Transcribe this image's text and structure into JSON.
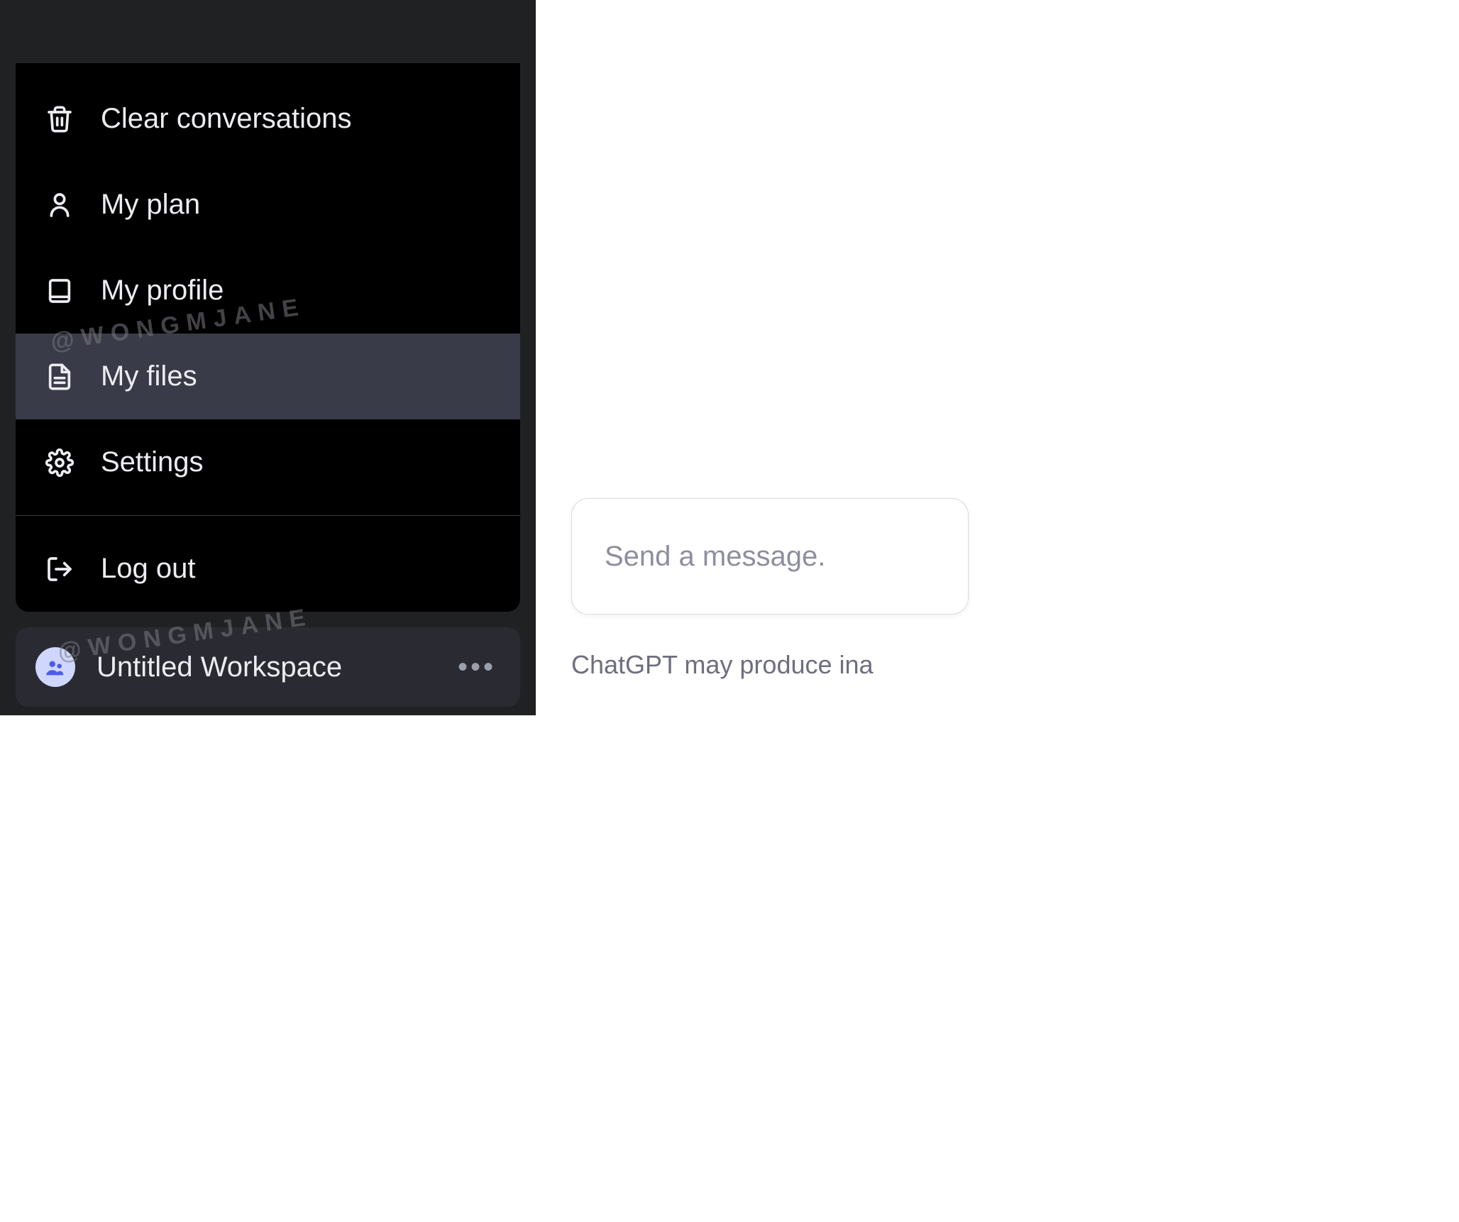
{
  "sidebar": {
    "items": [
      {
        "label": "Clear conversations",
        "icon": "trash-icon"
      },
      {
        "label": "My plan",
        "icon": "person-icon"
      },
      {
        "label": "My profile",
        "icon": "book-icon"
      },
      {
        "label": "My files",
        "icon": "file-icon",
        "highlighted": true
      },
      {
        "label": "Settings",
        "icon": "gear-icon"
      }
    ],
    "logout_label": "Log out"
  },
  "workspace": {
    "label": "Untitled Workspace"
  },
  "chat": {
    "placeholder": "Send a message.",
    "disclaimer": "ChatGPT may produce ina"
  },
  "watermark": "@WONGMJANE"
}
